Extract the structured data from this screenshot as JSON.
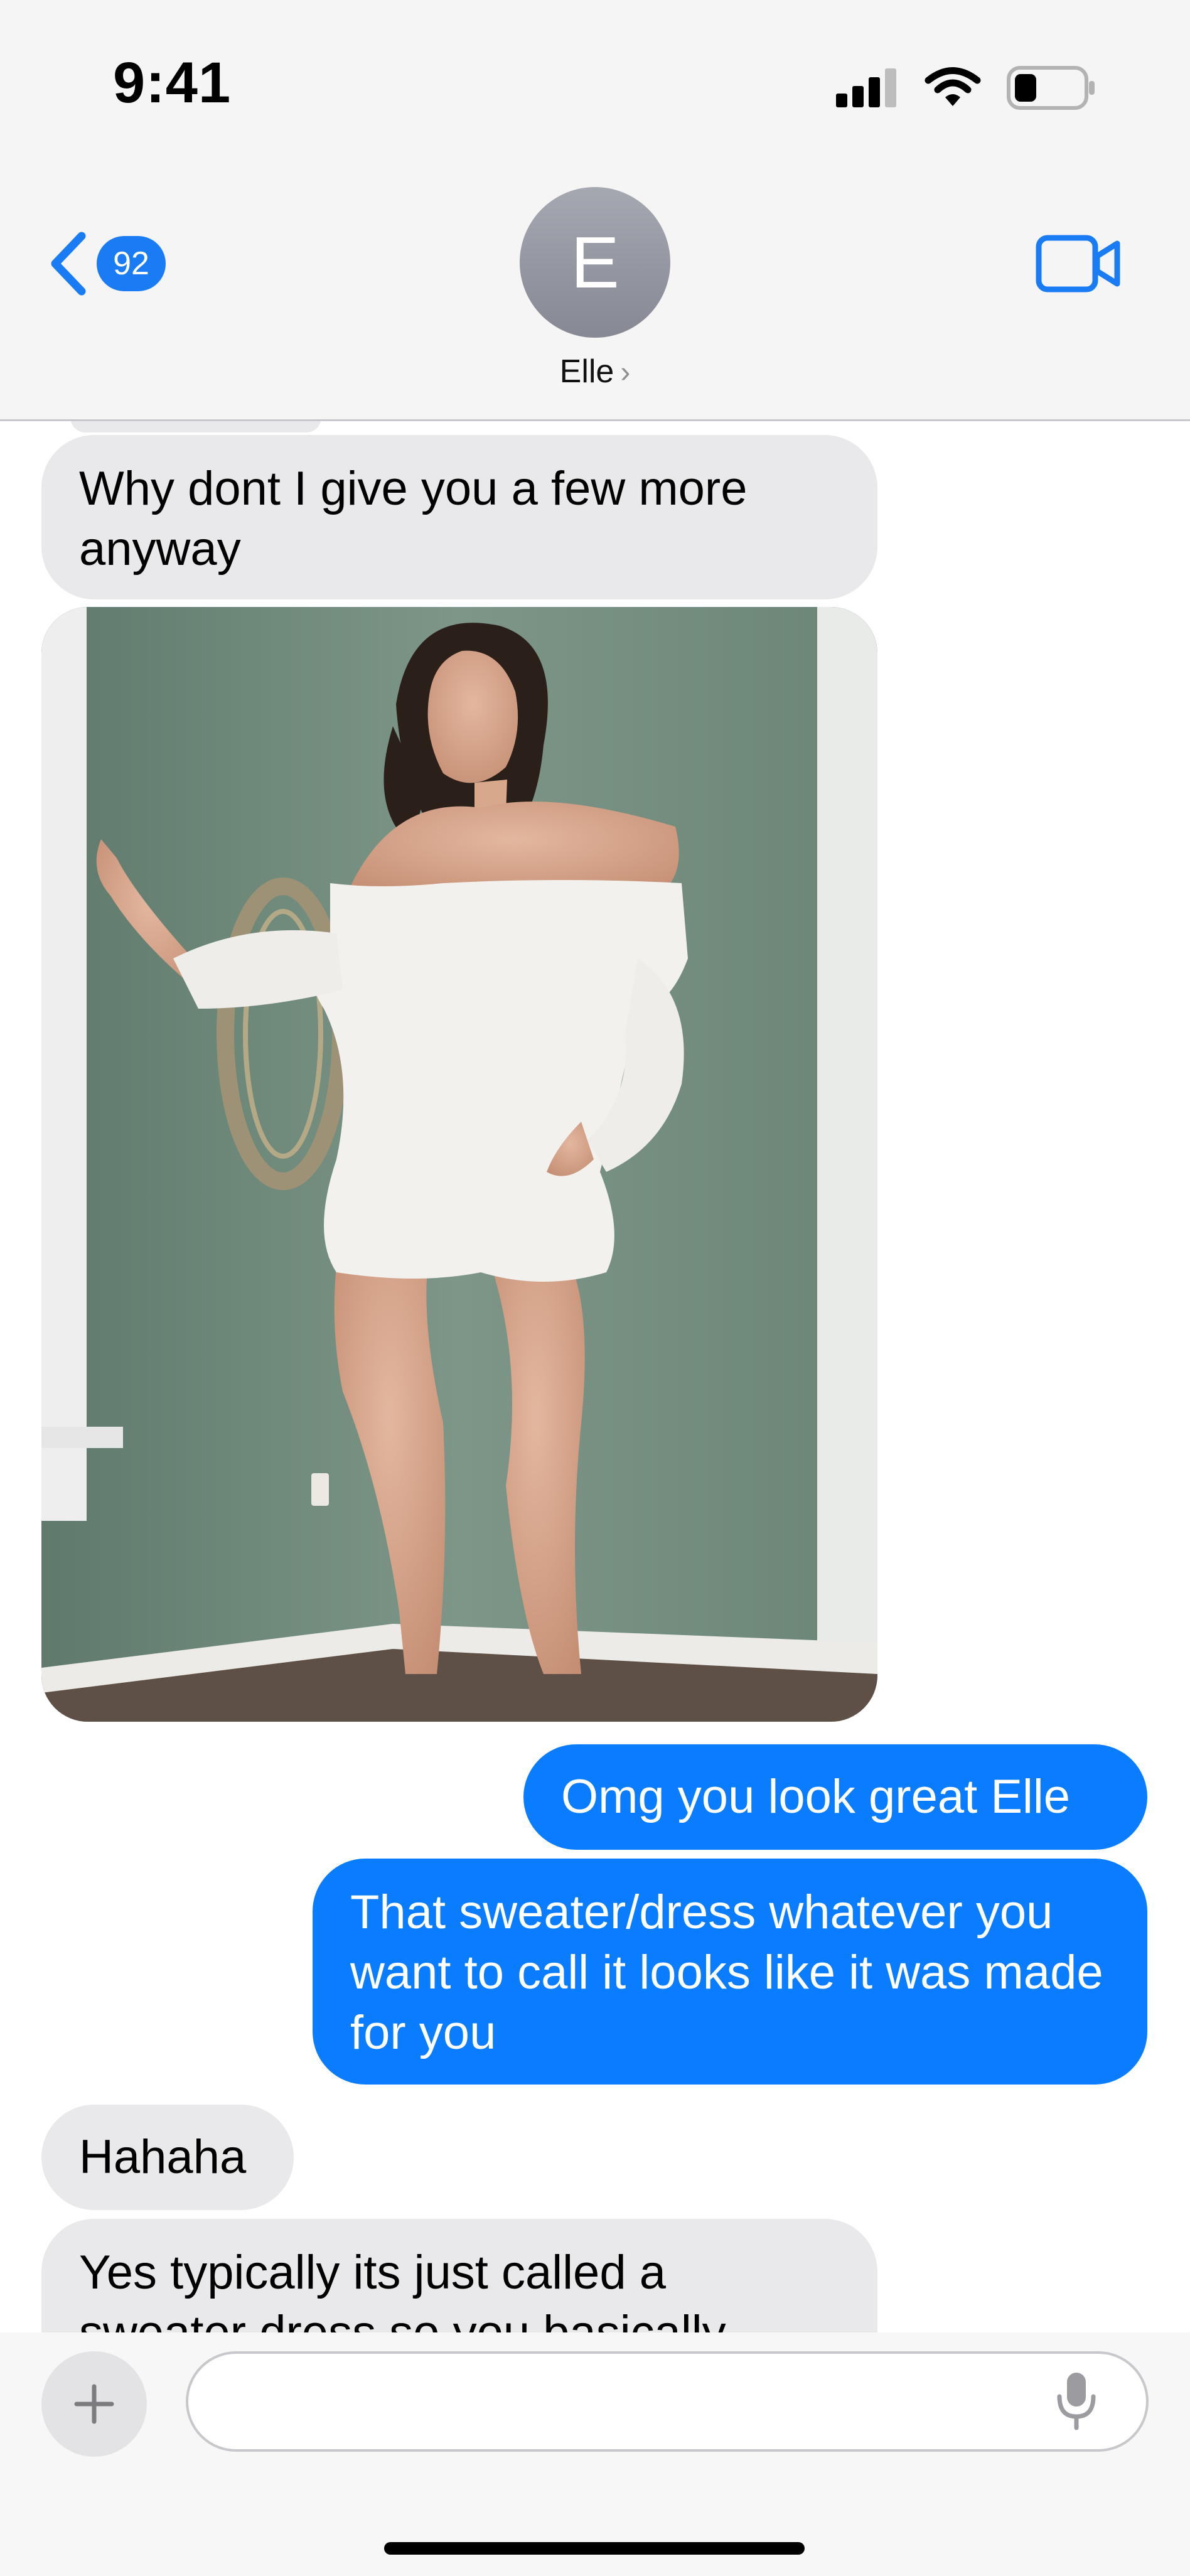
{
  "status_bar": {
    "time": "9:41",
    "icons": [
      "cellular-signal-icon",
      "wifi-icon",
      "battery-icon"
    ],
    "battery_level": 0.3
  },
  "header": {
    "back_count": "92",
    "avatar_initial": "E",
    "contact_name": "Elle",
    "video_icon": "video-camera-icon"
  },
  "messages": [
    {
      "side": "incoming",
      "text": "Why dont I give you a few more anyway"
    },
    {
      "side": "incoming",
      "type": "photo",
      "subject": "woman-in-white-sweater-dress"
    },
    {
      "side": "outgoing",
      "text": "Omg you look great Elle"
    },
    {
      "side": "outgoing",
      "text": "That sweater/dress whatever you want to call it looks like it was made for you"
    },
    {
      "side": "incoming",
      "text": "Hahaha"
    },
    {
      "side": "incoming",
      "text": "Yes typically its just called a sweater dress so you basically"
    }
  ],
  "composer": {
    "placeholder": "",
    "add_icon": "plus-icon",
    "mic_icon": "microphone-icon"
  },
  "colors": {
    "outgoing_bubble": "#0a7cff",
    "incoming_bubble": "#e9e9eb",
    "accent": "#1a7cf5"
  }
}
